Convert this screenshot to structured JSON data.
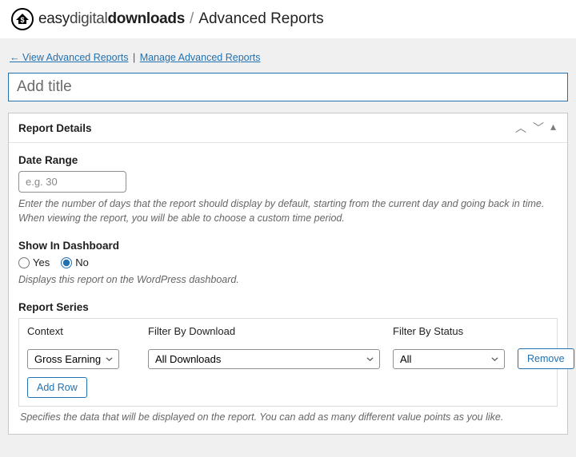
{
  "brand": {
    "p1": "easy",
    "p2": "digital",
    "p3": "downloads"
  },
  "page_title": "Advanced Reports",
  "nav": {
    "back": "← View Advanced Reports",
    "manage": "Manage Advanced Reports"
  },
  "title_placeholder": "Add title",
  "panel": {
    "heading": "Report Details",
    "date_range": {
      "label": "Date Range",
      "placeholder": "e.g. 30",
      "desc": "Enter the number of days that the report should display by default, starting from the current day and going back in time. When viewing the report, you will be able to choose a custom time period."
    },
    "show_dash": {
      "label": "Show In Dashboard",
      "yes": "Yes",
      "no": "No",
      "desc": "Displays this report on the WordPress dashboard."
    },
    "series": {
      "label": "Report Series",
      "cols": {
        "context": "Context",
        "download": "Filter By Download",
        "status": "Filter By Status"
      },
      "row": {
        "context": "Gross Earnings",
        "download": "All Downloads",
        "status": "All"
      },
      "remove": "Remove",
      "add": "Add Row",
      "desc": "Specifies the data that will be displayed on the report. You can add as many different value points as you like."
    }
  }
}
